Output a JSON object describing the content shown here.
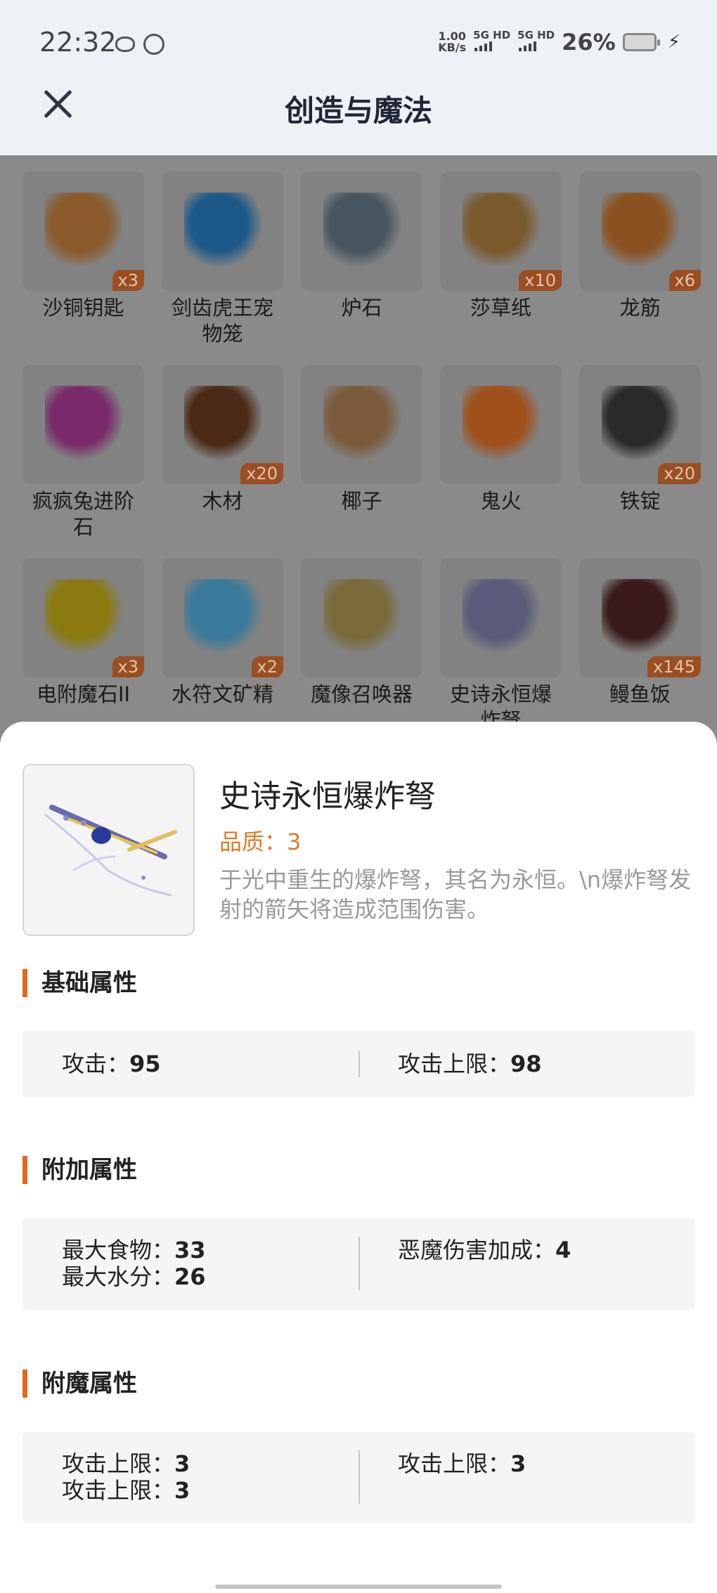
{
  "status_bar": {
    "time": "22:32",
    "net_speed_value": "1.00",
    "net_speed_unit": "KB/s",
    "sim1": "5G HD",
    "sim2": "5G HD",
    "battery": "26%"
  },
  "header": {
    "title": "创造与魔法",
    "close_icon": "close-icon"
  },
  "grid": {
    "rows": [
      [
        {
          "name": "沙铜钥匙",
          "badge": "x3",
          "icon": "key-icon",
          "color": "#8a5a2a"
        },
        {
          "name": "剑齿虎王宠物笼",
          "badge": "",
          "icon": "pet-cage-icon",
          "color": "#1d5a8a"
        },
        {
          "name": "炉石",
          "badge": "",
          "icon": "stone-icon",
          "color": "#465560"
        },
        {
          "name": "莎草纸",
          "badge": "x10",
          "icon": "papyrus-icon",
          "color": "#7a5a2c"
        },
        {
          "name": "龙筋",
          "badge": "x6",
          "icon": "sinew-icon",
          "color": "#8a5220"
        }
      ],
      [
        {
          "name": "疯疯兔进阶石",
          "badge": "",
          "icon": "gem-icon",
          "color": "#7a2a6a"
        },
        {
          "name": "木材",
          "badge": "x20",
          "icon": "wood-icon",
          "color": "#4a2a14"
        },
        {
          "name": "椰子",
          "badge": "",
          "icon": "coconut-icon",
          "color": "#7a5a3a"
        },
        {
          "name": "鬼火",
          "badge": "",
          "icon": "fire-icon",
          "color": "#a0501a"
        },
        {
          "name": "铁锭",
          "badge": "x20",
          "icon": "iron-ingot-icon",
          "color": "#2a2a2a"
        }
      ],
      [
        {
          "name": "电附魔石II",
          "badge": "x3",
          "icon": "gold-stone-icon",
          "color": "#8a7a10"
        },
        {
          "name": "水符文矿精",
          "badge": "x2",
          "icon": "crystal-icon",
          "color": "#3a7a9a"
        },
        {
          "name": "魔像召唤器",
          "badge": "",
          "icon": "summoner-icon",
          "color": "#7a6a3a"
        },
        {
          "name": "史诗永恒爆炸弩",
          "badge": "",
          "icon": "crossbow-icon",
          "color": "#5a5a7a"
        },
        {
          "name": "鳗鱼饭",
          "badge": "x145",
          "icon": "rice-bowl-icon",
          "color": "#3a1a1a"
        }
      ]
    ]
  },
  "detail": {
    "title": "史诗永恒爆炸弩",
    "quality": "品质：3",
    "description": "于光中重生的爆炸弩，其名为永恒。\\n爆炸弩发射的箭矢将造成范围伤害。",
    "icon": "crossbow-icon",
    "sections": {
      "base": {
        "title": "基础属性",
        "left": [
          {
            "label": "攻击：",
            "value": "95"
          }
        ],
        "right": [
          {
            "label": "攻击上限：",
            "value": "98"
          }
        ]
      },
      "extra": {
        "title": "附加属性",
        "left": [
          {
            "label": "最大食物：",
            "value": "33"
          },
          {
            "label": "最大水分：",
            "value": "26"
          }
        ],
        "right": [
          {
            "label": "恶魔伤害加成：",
            "value": "4"
          }
        ]
      },
      "enchant": {
        "title": "附魔属性",
        "left": [
          {
            "label": "攻击上限：",
            "value": "3"
          },
          {
            "label": "攻击上限：",
            "value": "3"
          }
        ],
        "right": [
          {
            "label": "攻击上限：",
            "value": "3"
          }
        ]
      }
    }
  }
}
